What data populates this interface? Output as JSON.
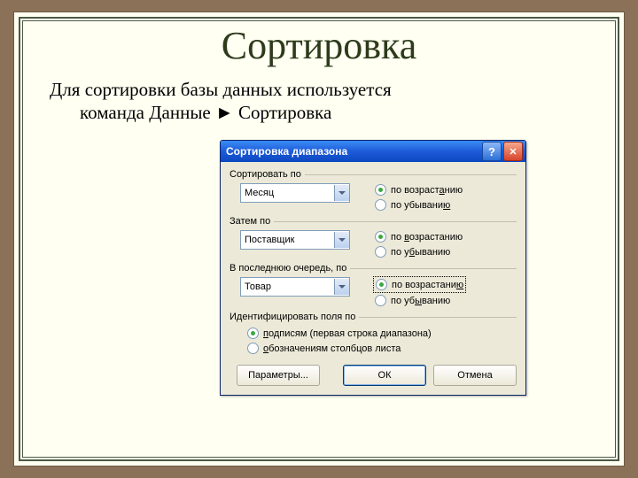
{
  "slide": {
    "title": "Сортировка",
    "subtitle_line1": "Для сортировки базы данных используется",
    "subtitle_line2_prefix": "команда Данные",
    "subtitle_line2_suffix": "Сортировка"
  },
  "dialog": {
    "title": "Сортировка диапазона",
    "group1_label": "Сортировать по",
    "group2_label": "Затем по",
    "group3_label": "В последнюю очередь, по",
    "combo1_value": "Месяц",
    "combo2_value": "Поставщик",
    "combo3_value": "Товар",
    "radio_asc": "по возрастанию",
    "radio_desc": "по убыванию",
    "identify_label": "Идентифицировать поля по",
    "identify_opt1": "подписям (первая строка диапазона)",
    "identify_opt2": "обозначениям столбцов листа",
    "btn_params": "Параметры...",
    "btn_ok": "ОК",
    "btn_cancel": "Отмена"
  }
}
